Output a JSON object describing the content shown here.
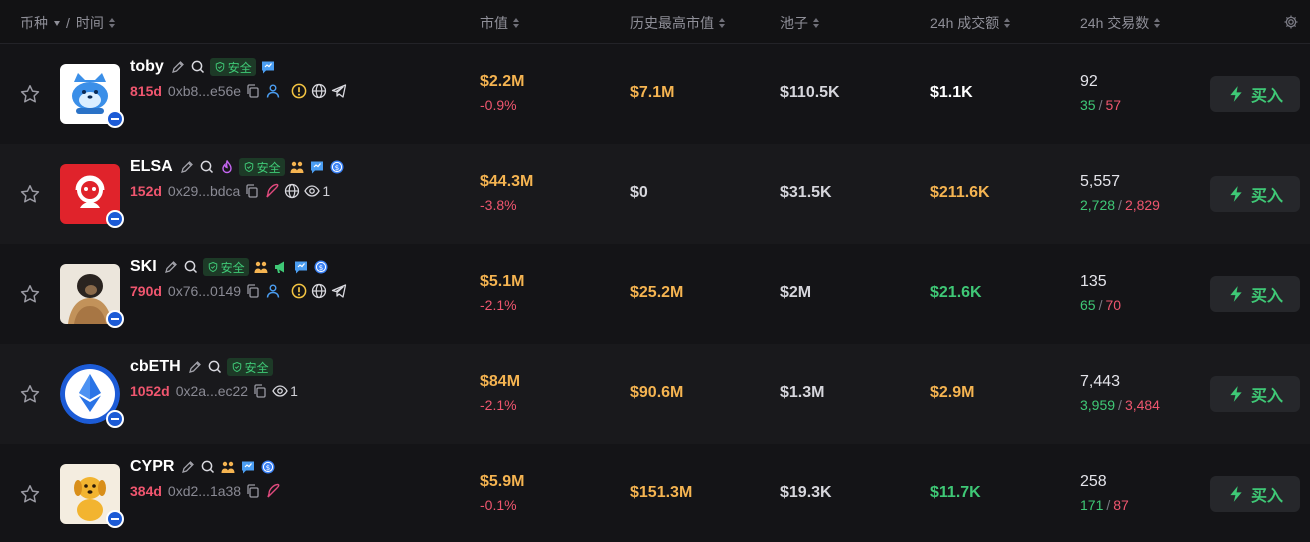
{
  "header": {
    "coin_label": "币种",
    "divider": "/",
    "time_label": "时间",
    "market_cap": "市值",
    "ath_market_cap": "历史最高市值",
    "pool": "池子",
    "volume_24h": "24h 成交额",
    "txns_24h": "24h 交易数"
  },
  "colors": {
    "accent_green": "#3fc876",
    "accent_red": "#f0566f",
    "accent_gold": "#f5b451",
    "background": "#141417"
  },
  "rows": [
    {
      "ticker": "toby",
      "age": "815d",
      "address": "0xb8...e56e",
      "safe_label": "安全",
      "viewers": "",
      "market_cap": "$2.2M",
      "change": "-0.9%",
      "ath": "$7.1M",
      "pool": "$110.5K",
      "volume": "$1.1K",
      "txns": "92",
      "buys": "35",
      "sells": "57",
      "buy_label": "买入"
    },
    {
      "ticker": "ELSA",
      "age": "152d",
      "address": "0x29...bdca",
      "safe_label": "安全",
      "viewers": "1",
      "market_cap": "$44.3M",
      "change": "-3.8%",
      "ath": "$0",
      "pool": "$31.5K",
      "volume": "$211.6K",
      "txns": "5,557",
      "buys": "2,728",
      "sells": "2,829",
      "buy_label": "买入"
    },
    {
      "ticker": "SKI",
      "age": "790d",
      "address": "0x76...0149",
      "safe_label": "安全",
      "viewers": "",
      "market_cap": "$5.1M",
      "change": "-2.1%",
      "ath": "$25.2M",
      "pool": "$2M",
      "volume": "$21.6K",
      "txns": "135",
      "buys": "65",
      "sells": "70",
      "buy_label": "买入"
    },
    {
      "ticker": "cbETH",
      "age": "1052d",
      "address": "0x2a...ec22",
      "safe_label": "安全",
      "viewers": "1",
      "market_cap": "$84M",
      "change": "-2.1%",
      "ath": "$90.6M",
      "pool": "$1.3M",
      "volume": "$2.9M",
      "txns": "7,443",
      "buys": "3,959",
      "sells": "3,484",
      "buy_label": "买入"
    },
    {
      "ticker": "CYPR",
      "age": "384d",
      "address": "0xd2...1a38",
      "safe_label": "",
      "viewers": "",
      "market_cap": "$5.9M",
      "change": "-0.1%",
      "ath": "$151.3M",
      "pool": "$19.3K",
      "volume": "$11.7K",
      "txns": "258",
      "buys": "171",
      "sells": "87",
      "buy_label": "买入"
    }
  ]
}
